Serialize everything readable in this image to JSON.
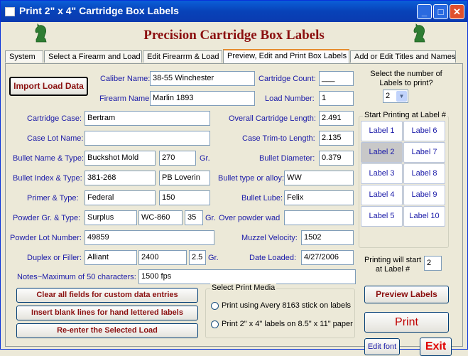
{
  "window": {
    "title": "Print 2\"  x  4\" Cartridge Box Labels"
  },
  "header": {
    "title": "Precision Cartridge Box Labels"
  },
  "tabs": [
    {
      "label": "System"
    },
    {
      "label": "Select a Firearm and Load"
    },
    {
      "label": "Edit Firearrm & Load"
    },
    {
      "label": "Preview, Edit and Print Box Labels"
    },
    {
      "label": "Add or Edit Titles and Names"
    }
  ],
  "import_button": "Import Load Data",
  "fields": {
    "caliber_name": {
      "label": "Caliber Name:",
      "value": "38-55 Winchester"
    },
    "firearm_name": {
      "label": "Firearm Name:",
      "value": "Marlin 1893"
    },
    "cartridge_count": {
      "label": "Cartridge Count:",
      "value": "___"
    },
    "load_number": {
      "label": "Load Number:",
      "value": "1"
    },
    "cartridge_case": {
      "label": "Cartridge Case:",
      "value": "Bertram"
    },
    "case_lot_name": {
      "label": "Case Lot Name:",
      "value": ""
    },
    "bullet_name": {
      "label": "Bullet Name & Type:",
      "value": "Buckshot Mold",
      "value2": "270",
      "unit": "Gr."
    },
    "bullet_index": {
      "label": "Bullet Index & Type:",
      "value": "381-268",
      "value2": "PB Loverin"
    },
    "primer": {
      "label": "Primer & Type:",
      "value": "Federal",
      "value2": "150"
    },
    "powder": {
      "label": "Powder Gr. & Type:",
      "value": "Surplus",
      "value2": "WC-860",
      "value3": "35",
      "unit": "Gr."
    },
    "powder_lot": {
      "label": "Powder Lot Number:",
      "value": "49859"
    },
    "duplex": {
      "label": "Duplex or Filler:",
      "value": "Alliant",
      "value2": "2400",
      "value3": "2.5",
      "unit": "Gr."
    },
    "overall_length": {
      "label": "Overall Cartridge Length:",
      "value": "2.491"
    },
    "trim_length": {
      "label": "Case Trim-to Length:",
      "value": "2.135"
    },
    "bullet_diameter": {
      "label": "Bullet Diameter:",
      "value": "0.379"
    },
    "bullet_alloy": {
      "label": "Bullet type or alloy:",
      "value": "WW"
    },
    "bullet_lube": {
      "label": "Bullet Lube:",
      "value": "Felix"
    },
    "over_powder": {
      "label": "Over powder wad",
      "value": ""
    },
    "muzzle_velocity": {
      "label": "Muzzel Velocity:",
      "value": "1502"
    },
    "date_loaded": {
      "label": "Date Loaded:",
      "value": "4/27/2006"
    },
    "notes": {
      "label": "Notes~Maximum of 50 characters:",
      "value": "1500 fps"
    }
  },
  "labels_to_print": {
    "label": "Select the number of Labels to print?",
    "value": "2"
  },
  "start_group": {
    "title": "Start Printing at Label #",
    "cells": [
      "Label 1",
      "Label 6",
      "Label 2",
      "Label 7",
      "Label 3",
      "Label 8",
      "Label 4",
      "Label 9",
      "Label 5",
      "Label 10"
    ]
  },
  "start_at": {
    "label": "Printing will start at Label #",
    "value": "2"
  },
  "buttons": {
    "clear": "Clear all fields for custom data entries",
    "insert_blank": "Insert blank lines for hand lettered labels",
    "reenter": "Re-enter the Selected Load",
    "preview": "Preview Labels",
    "print": "Print",
    "edit_font": "Edit font",
    "exit": "Exit"
  },
  "media": {
    "title": "Select Print Media",
    "opt1": "Print using Avery 8163 stick on labels",
    "opt2": "Print 2\" x 4\" labels on 8.5\" x 11\" paper"
  },
  "colors": {
    "accent": "#8b1010",
    "label_blue": "#1a1aa8"
  }
}
